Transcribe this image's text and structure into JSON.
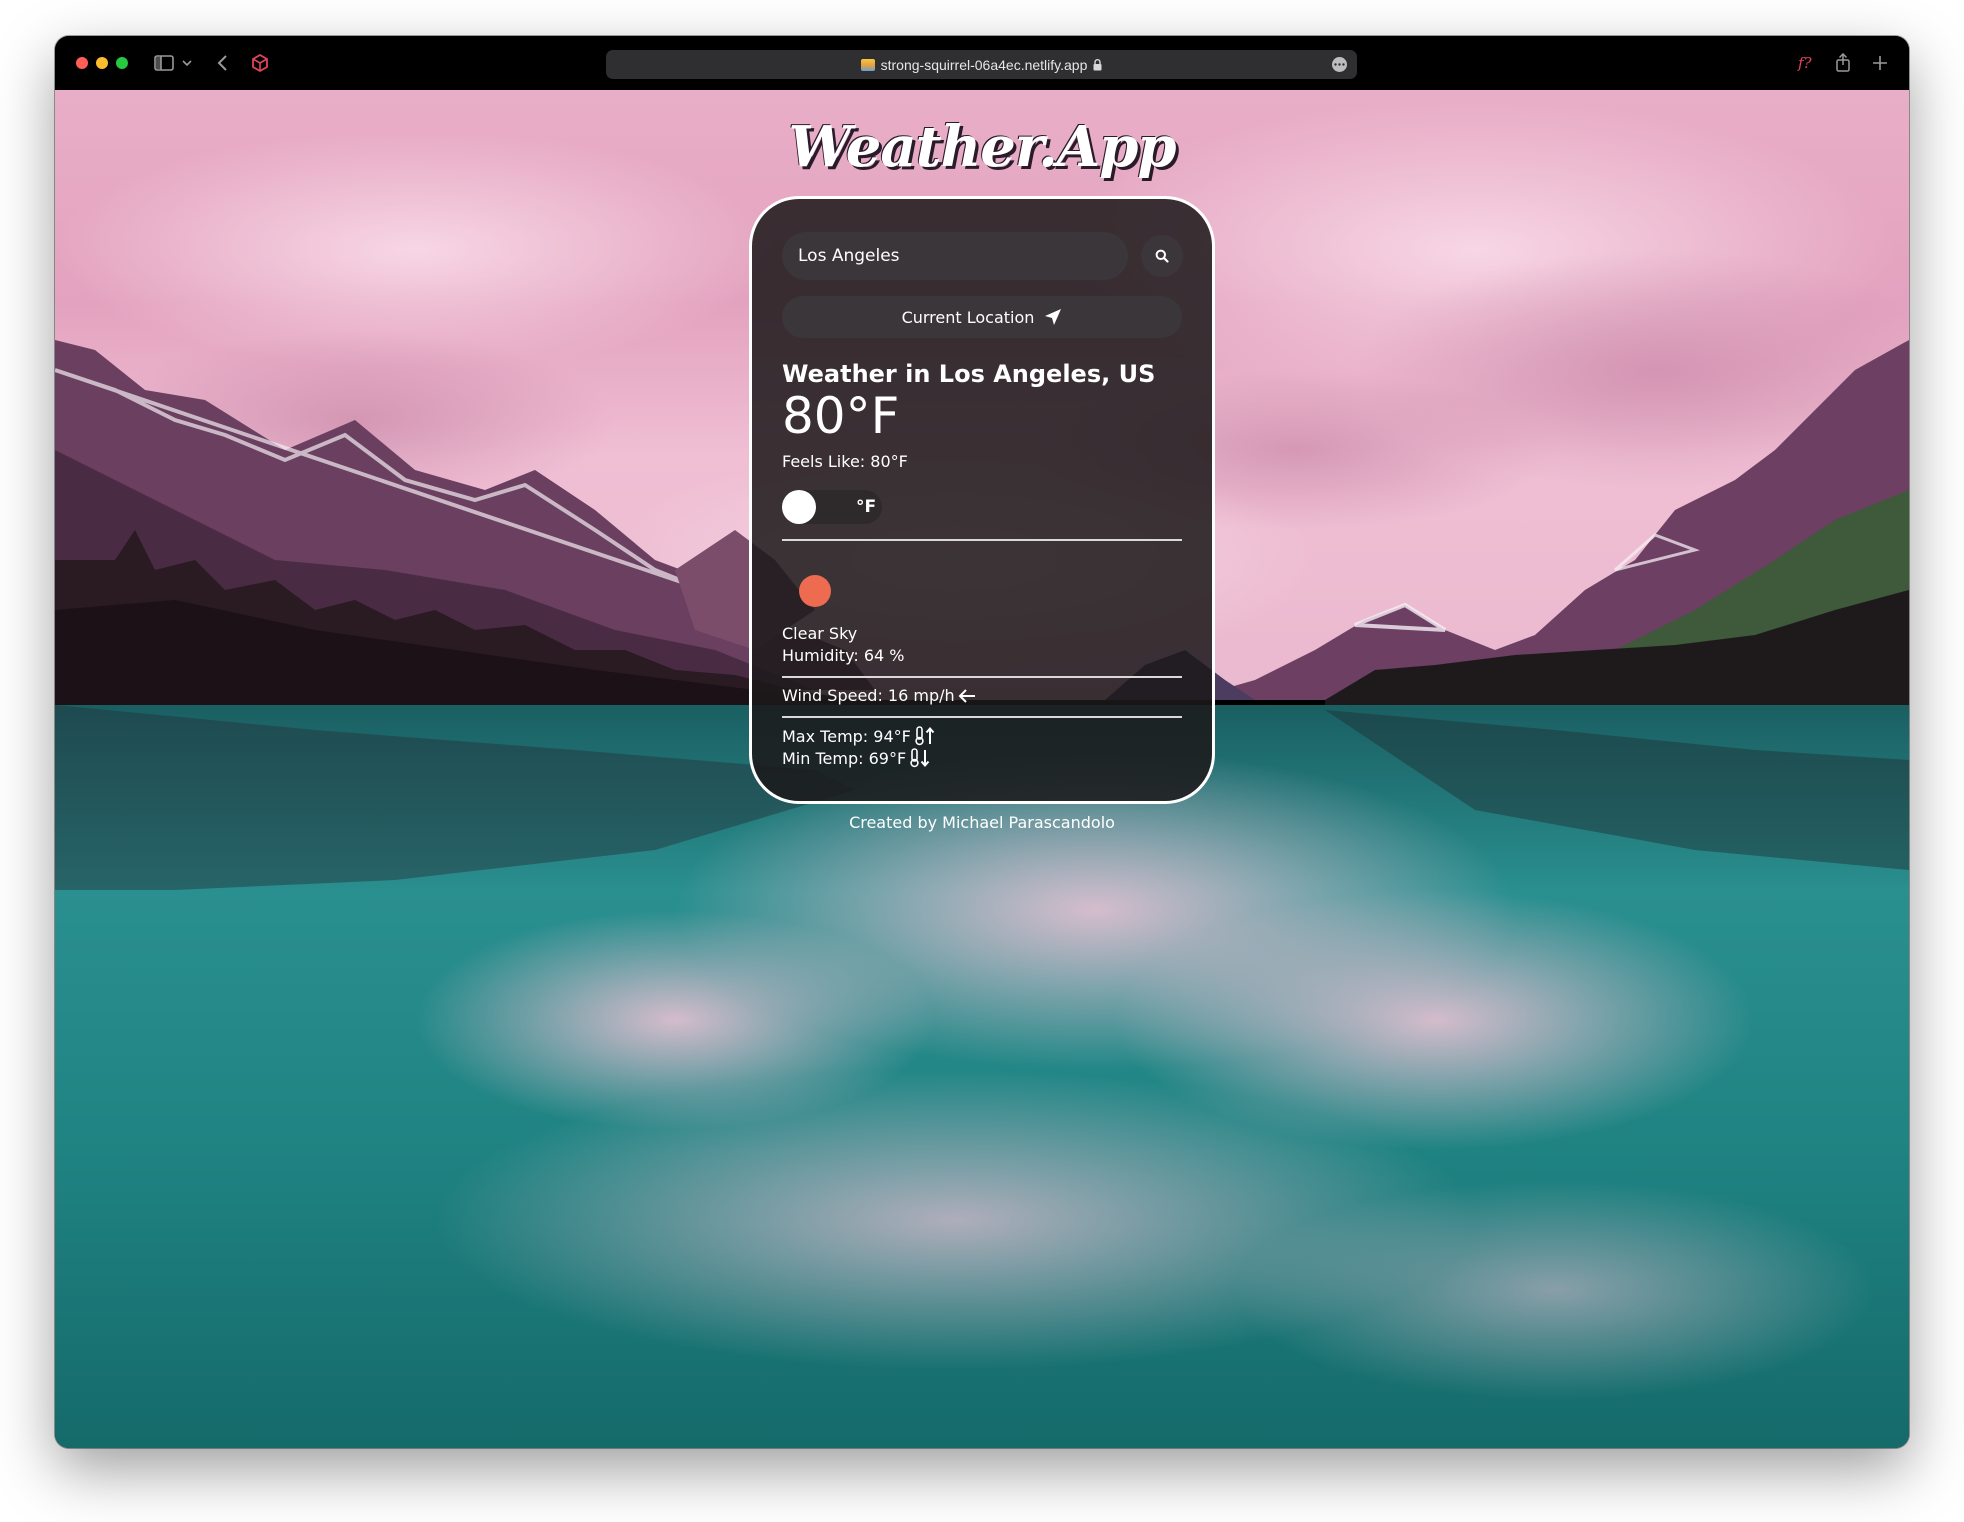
{
  "browser": {
    "url": "strong-squirrel-06a4ec.netlify.app",
    "icons": [
      "sidebar-icon",
      "chevron-down-icon",
      "back-icon",
      "extension-icon",
      "lock-icon",
      "more-icon",
      "formula-icon",
      "share-icon",
      "new-tab-icon"
    ]
  },
  "app": {
    "logo": "Weather.App"
  },
  "search": {
    "value": "Los Angeles",
    "icon": "search-icon"
  },
  "location_button": {
    "label": "Current Location",
    "icon": "location-arrow-icon"
  },
  "weather": {
    "heading": "Weather in Los Angeles, US",
    "temperature": "80°F",
    "feels_like": "Feels Like: 80°F",
    "unit_toggle": "°F",
    "icon": "clear-sky-icon",
    "icon_color": "#ec6b51",
    "description": "Clear Sky",
    "humidity": "Humidity: 64 %",
    "wind": "Wind Speed: 16 mp/h",
    "wind_icon": "arrow-left-icon",
    "max_temp": "Max Temp: 94°F",
    "max_icon": "thermometer-up-icon",
    "min_temp": "Min Temp: 69°F",
    "min_icon": "thermometer-down-icon"
  },
  "footer": {
    "credit": "Created by Michael Parascandolo"
  },
  "colors": {
    "card_bg": "#1c181a",
    "accent_sun": "#ec6b51"
  }
}
